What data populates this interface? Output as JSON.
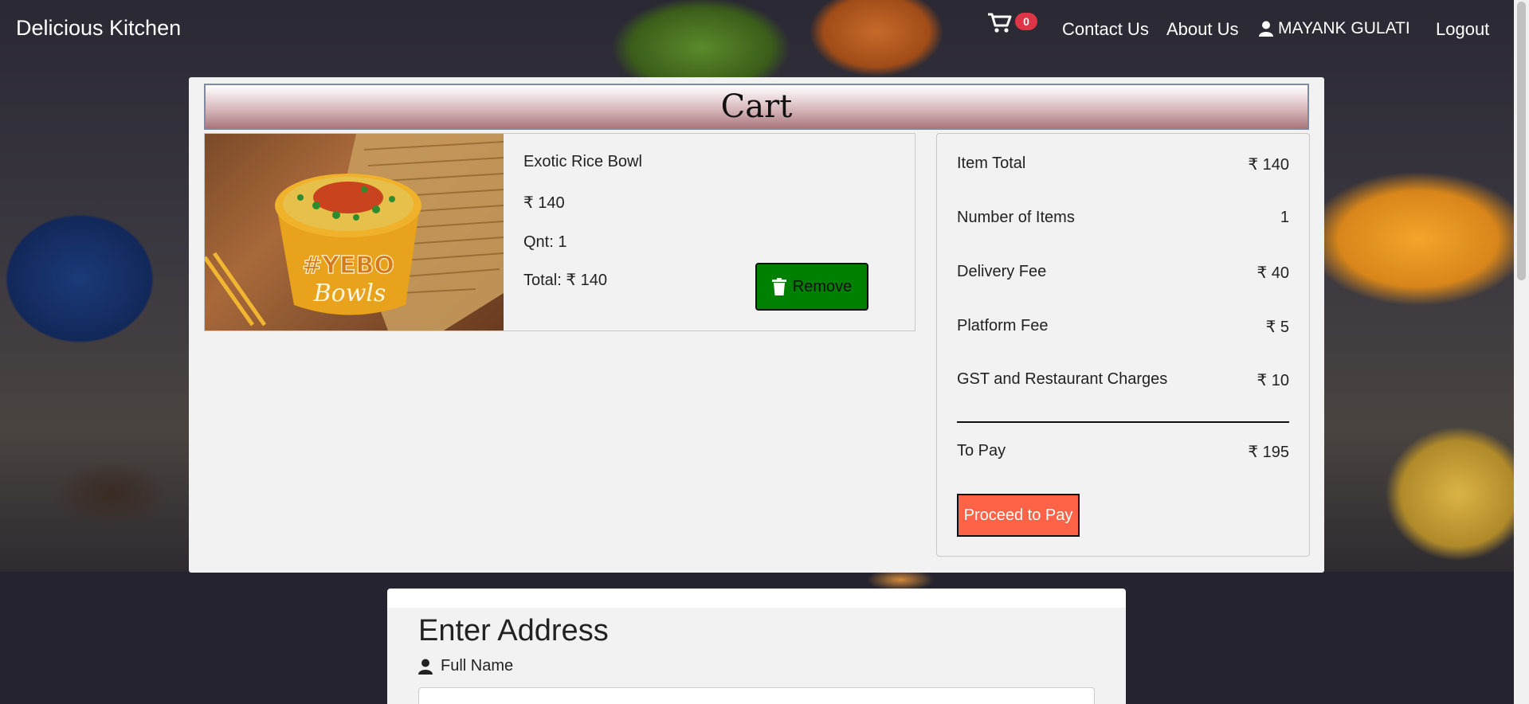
{
  "navbar": {
    "brand": "Delicious Kitchen",
    "cart_count": "0",
    "links": {
      "contact": "Contact Us",
      "about": "About Us",
      "logout": "Logout"
    },
    "user_name": "MAYANK GULATI"
  },
  "cart": {
    "title": "Cart",
    "item": {
      "name": "Exotic Rice Bowl",
      "price": "₹ 140",
      "quantity": "Qnt: 1",
      "total": "Total: ₹ 140",
      "remove_label": "Remove",
      "image_text_top": "#YEBO",
      "image_text_bottom": "Bowls"
    },
    "summary": {
      "rows": [
        {
          "label": "Item Total",
          "value": "₹ 140"
        },
        {
          "label": "Number of Items",
          "value": "1"
        },
        {
          "label": "Delivery Fee",
          "value": "₹ 40"
        },
        {
          "label": "Platform Fee",
          "value": "₹ 5"
        },
        {
          "label": "GST and Restaurant Charges",
          "value": "₹ 10"
        }
      ],
      "to_pay_label": "To Pay",
      "to_pay_value": "₹ 195",
      "pay_button": "Proceed to Pay"
    }
  },
  "address": {
    "title": "Enter Address",
    "full_name_label": "Full Name",
    "full_name_value": ""
  },
  "colors": {
    "remove_button": "#008000",
    "pay_button": "#ff6347",
    "badge": "#dc3545"
  }
}
